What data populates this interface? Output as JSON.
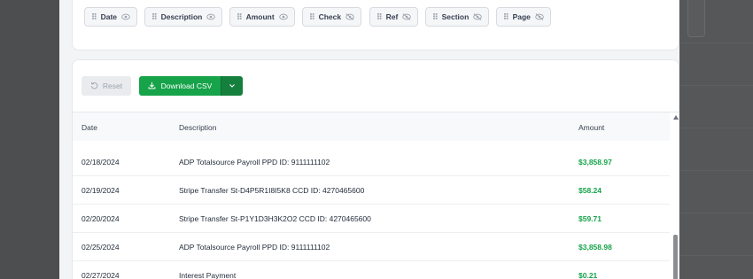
{
  "columns": [
    {
      "label": "Date",
      "visible": true
    },
    {
      "label": "Description",
      "visible": true
    },
    {
      "label": "Amount",
      "visible": true
    },
    {
      "label": "Check",
      "visible": false
    },
    {
      "label": "Ref",
      "visible": false
    },
    {
      "label": "Section",
      "visible": false
    },
    {
      "label": "Page",
      "visible": false
    }
  ],
  "toolbar": {
    "reset_label": "Reset",
    "download_label": "Download CSV"
  },
  "table": {
    "headers": {
      "date": "Date",
      "description": "Description",
      "amount": "Amount"
    },
    "rows": [
      {
        "date": "02/18/2024",
        "description": "ADP Totalsource Payroll PPD ID: 9111111102",
        "amount": "$3,858.97"
      },
      {
        "date": "02/19/2024",
        "description": "Stripe Transfer St-D4P5R1I8I5K8 CCD ID: 4270465600",
        "amount": "$58.24"
      },
      {
        "date": "02/20/2024",
        "description": "Stripe Transfer St-P1Y1D3H3K2O2 CCD ID: 4270465600",
        "amount": "$59.71"
      },
      {
        "date": "02/25/2024",
        "description": "ADP Totalsource Payroll PPD ID: 9111111102",
        "amount": "$3,858.98"
      },
      {
        "date": "02/27/2024",
        "description": "Interest Payment",
        "amount": "$0.21"
      }
    ]
  },
  "colors": {
    "primary": "#16a34a",
    "primary_dark": "#15803d",
    "amount_positive": "#16a34a"
  }
}
